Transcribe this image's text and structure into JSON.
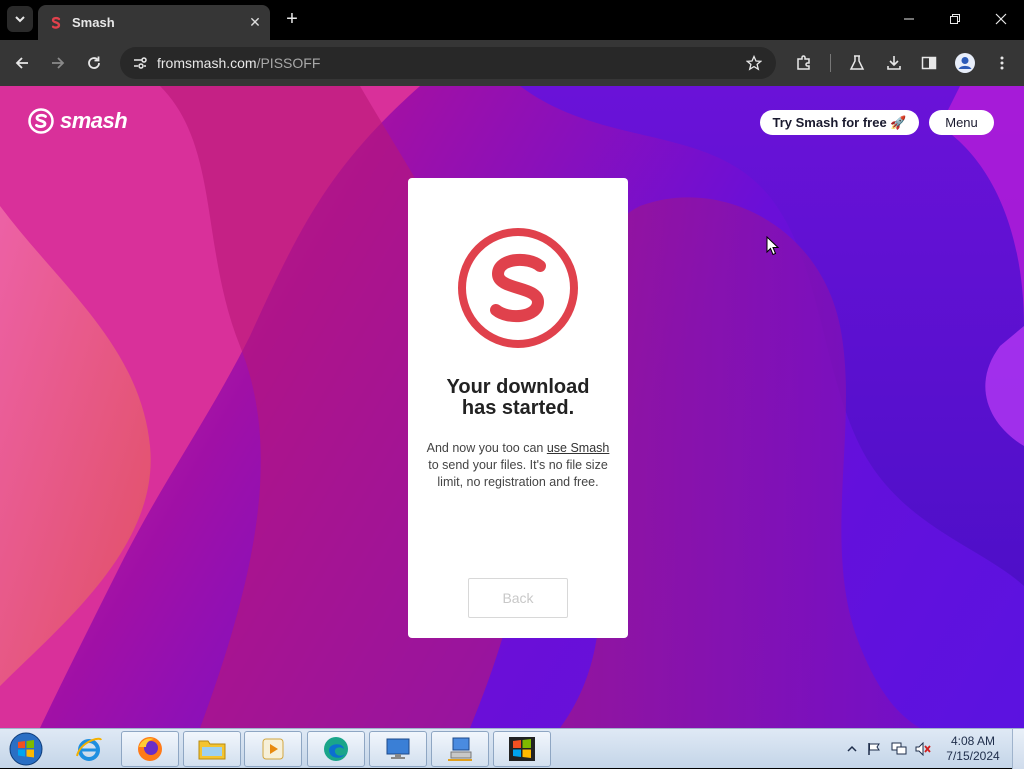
{
  "browser": {
    "tab_title": "Smash",
    "url_domain": "fromsmash.com",
    "url_path": "/PISSOFF",
    "tab_close_glyph": "✕",
    "new_tab_glyph": "+"
  },
  "page": {
    "logo_text": "smash",
    "try_button": "Try Smash for free 🚀",
    "menu_button": "Menu",
    "heading_line1": "Your download",
    "heading_line2": "has started.",
    "desc_before": "And now you too can ",
    "desc_link": "use Smash",
    "desc_after": " to send your files. It's no file size limit, no registration and free.",
    "back_button": "Back"
  },
  "taskbar": {
    "time": "4:08 AM",
    "date": "7/15/2024",
    "items": [
      "start-orb",
      "internet-explorer",
      "firefox",
      "file-explorer",
      "media-player",
      "edge",
      "remote-desktop",
      "network-computer",
      "windows-logo-app"
    ]
  },
  "colors": {
    "brand_red": "#e0414c",
    "browser_dark": "#363636",
    "page_purple": "#6a0fd8"
  }
}
